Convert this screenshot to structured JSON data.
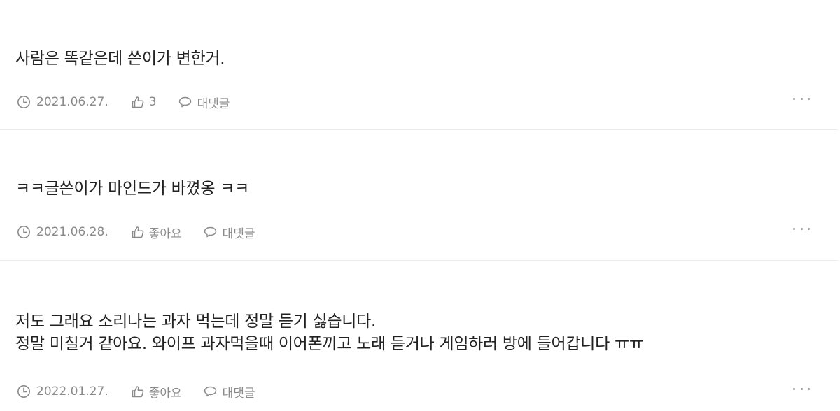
{
  "comments": [
    {
      "lines": [
        "사람은 똑같은데 쓴이가 변한거."
      ],
      "date": "2021.06.27.",
      "like_label": "3",
      "reply_label": "대댓글"
    },
    {
      "lines": [
        "ㅋㅋ글쓴이가 마인드가 바꼈옹 ㅋㅋ"
      ],
      "date": "2021.06.28.",
      "like_label": "좋아요",
      "reply_label": "대댓글"
    },
    {
      "lines": [
        "저도 그래요 소리나는 과자 먹는데 정말 듣기 싫습니다.",
        "정말 미칠거 같아요. 와이프 과자먹을때 이어폰끼고 노래 듣거나 게임하러 방에 들어갑니다 ㅠㅠ"
      ],
      "date": "2022.01.27.",
      "like_label": "좋아요",
      "reply_label": "대댓글"
    }
  ],
  "icons": {
    "date": "clock-icon",
    "like": "thumbs-up-icon",
    "reply": "speech-bubble-icon",
    "more": "more-dots-icon"
  },
  "colors": {
    "text": "#222222",
    "meta": "#8a8a8a",
    "divider": "#ececec"
  }
}
